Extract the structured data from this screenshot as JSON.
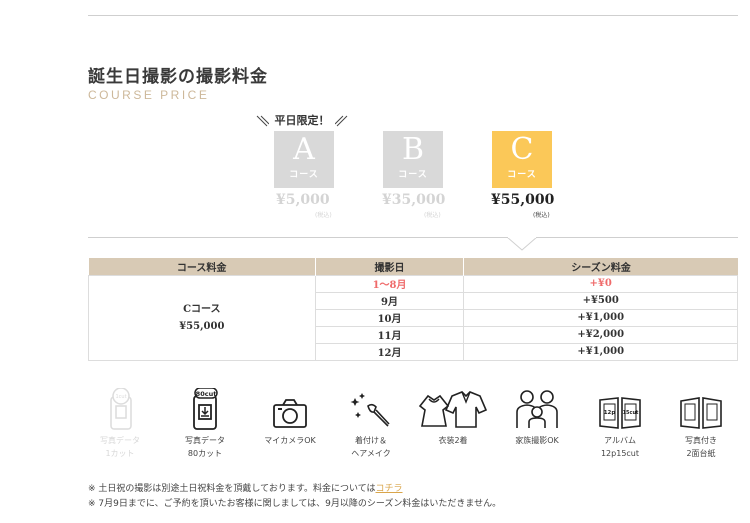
{
  "section": {
    "title": "誕生日撮影の撮影料金",
    "subtitle": "COURSE PRICE",
    "limited_label": "平日限定！"
  },
  "courses": [
    {
      "letter": "A",
      "sub": "コース",
      "price": "¥5,000",
      "tax": "(税込)"
    },
    {
      "letter": "B",
      "sub": "コース",
      "price": "¥35,000",
      "tax": "(税込)"
    },
    {
      "letter": "C",
      "sub": "コース",
      "price": "¥55,000",
      "tax": "(税込)"
    }
  ],
  "table": {
    "headers": [
      "コース料金",
      "撮影日",
      "シーズン料金"
    ],
    "course_name": "Cコース",
    "course_price": "¥55,000",
    "rows": [
      {
        "date": "1〜8月",
        "fee": "+¥0"
      },
      {
        "date": "9月",
        "fee": "+¥500"
      },
      {
        "date": "10月",
        "fee": "+¥1,000"
      },
      {
        "date": "11月",
        "fee": "+¥2,000"
      },
      {
        "date": "12月",
        "fee": "+¥1,000"
      }
    ]
  },
  "features": [
    {
      "line1": "写真データ",
      "line2": "1カット",
      "badge": "1cut"
    },
    {
      "line1": "写真データ",
      "line2": "80カット",
      "badge": "80cut"
    },
    {
      "line1": "マイカメラOK",
      "line2": ""
    },
    {
      "line1": "着付け＆",
      "line2": "ヘアメイク"
    },
    {
      "line1": "衣装2着",
      "line2": ""
    },
    {
      "line1": "家族撮影OK",
      "line2": ""
    },
    {
      "line1": "アルバム",
      "line2": "12p15cut",
      "album_left": "12p",
      "album_right": "15cut"
    },
    {
      "line1": "写真付き",
      "line2": "2面台紙"
    }
  ],
  "notes": {
    "note1_text": "※ 土日祝の撮影は別途土日祝料金を頂戴しております。料金については",
    "note1_link": "コチラ",
    "note2_text": "※ 7月9日までに、ご予約を頂いたお客様に関しましては、9月以降のシーズン料金はいただきません。"
  },
  "colors": {
    "accent": "#fbc858",
    "header": "#d8cab5",
    "highlight": "#ef6a6a",
    "subtitle": "#cdb89a",
    "link": "#d9a54b"
  }
}
